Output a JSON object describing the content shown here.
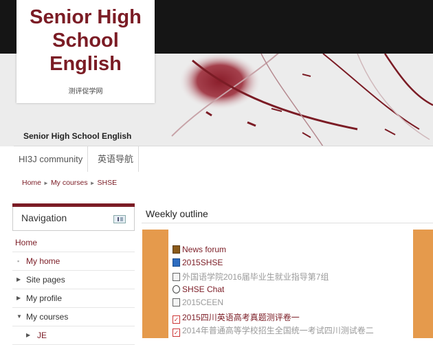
{
  "header": {
    "logo_title_line1": "Senior High",
    "logo_title_line2": "School English",
    "logo_subtitle": "测评促学网",
    "site_name": "Senior High School English"
  },
  "nav_tabs": [
    {
      "label": "HI3J community"
    },
    {
      "label": "英语导航"
    }
  ],
  "breadcrumb": {
    "items": [
      "Home",
      "My courses",
      "SHSE"
    ],
    "separator": "►"
  },
  "navigation_block": {
    "title": "Navigation",
    "items": [
      {
        "label": "Home"
      },
      {
        "label": "My home"
      },
      {
        "label": "Site pages"
      },
      {
        "label": "My profile"
      },
      {
        "label": "My courses"
      },
      {
        "label": "JE"
      }
    ]
  },
  "main": {
    "title": "Weekly outline",
    "activities": [
      {
        "label": "News forum",
        "icon": "forum-icon"
      },
      {
        "label": "2015SHSE",
        "icon": "url-icon"
      },
      {
        "label": "外国语学院2016届毕业生就业指导第7组",
        "icon": "file-icon"
      },
      {
        "label": "SHSE Chat",
        "icon": "chat-icon"
      },
      {
        "label": "2015CEEN",
        "icon": "file-icon"
      },
      {
        "label": "2015四川英语高考真题测评卷一",
        "icon": "quiz-icon"
      },
      {
        "label": "2014年普通高等学校招生全国统一考试四川测试卷二",
        "icon": "quiz-icon"
      }
    ]
  },
  "colors": {
    "accent": "#7b1c25",
    "section_band": "#e59a4c",
    "header_dark": "#151515"
  }
}
